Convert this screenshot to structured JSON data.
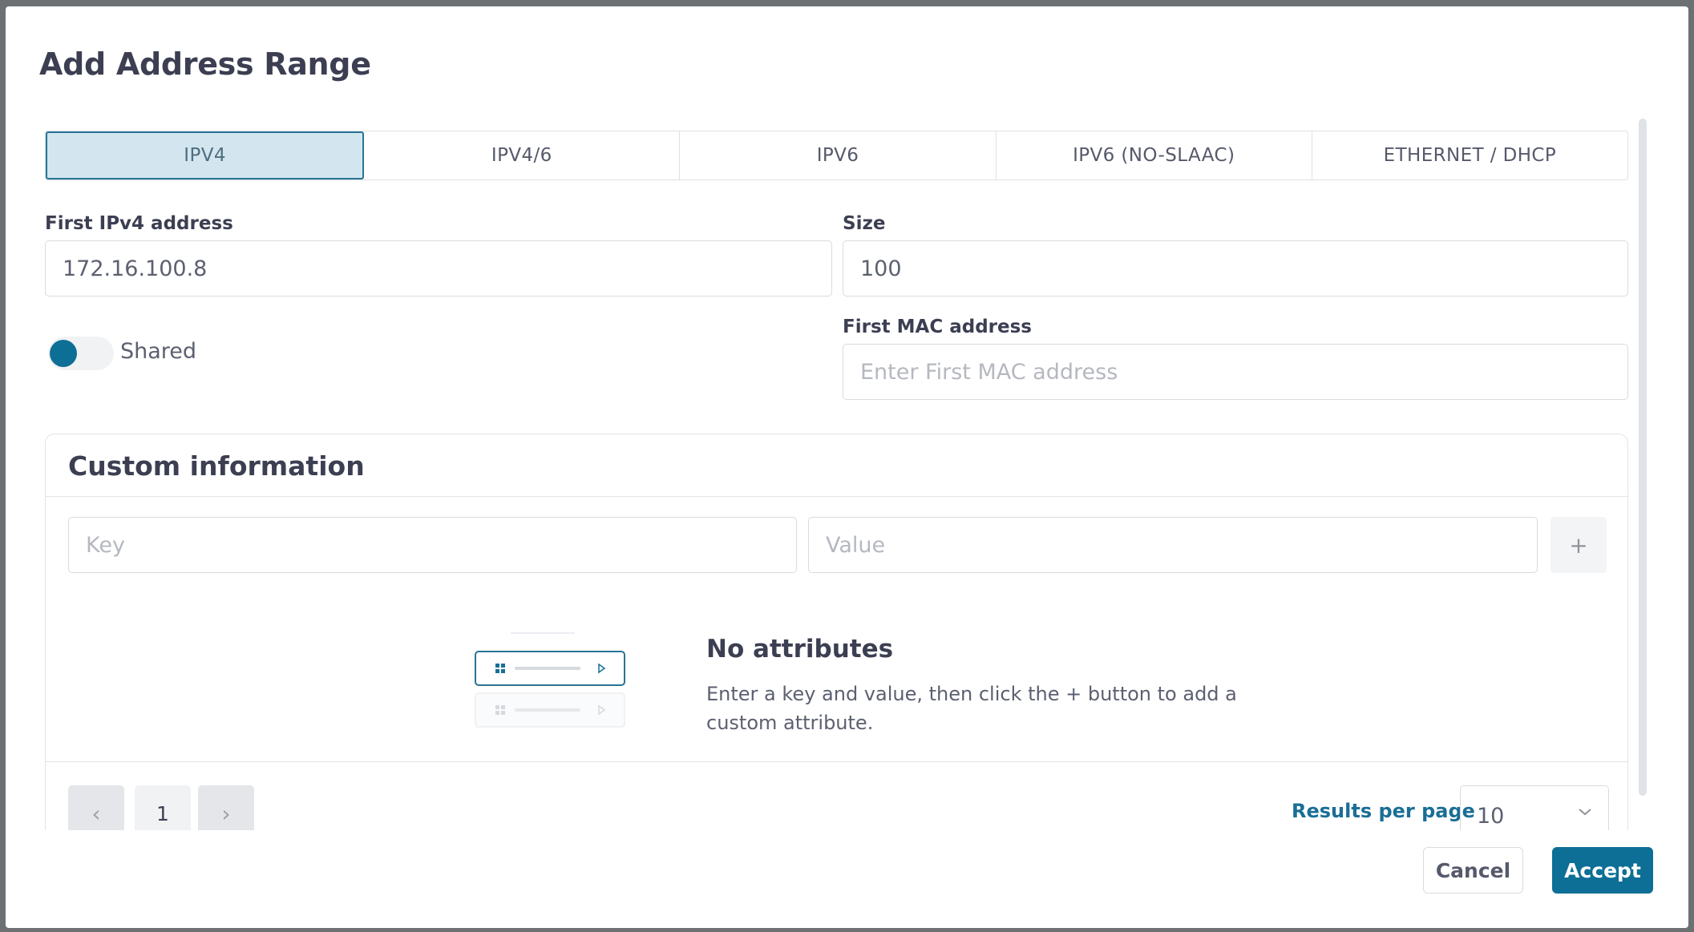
{
  "dialog": {
    "title": "Add Address Range"
  },
  "tabs": [
    {
      "label": "IPV4",
      "active": true
    },
    {
      "label": "IPV4/6",
      "active": false
    },
    {
      "label": "IPV6",
      "active": false
    },
    {
      "label": "IPV6 (NO-SLAAC)",
      "active": false
    },
    {
      "label": "ETHERNET / DHCP",
      "active": false
    }
  ],
  "form": {
    "first_ip_label": "First IPv4 address",
    "first_ip_value": "172.16.100.8",
    "size_label": "Size",
    "size_value": "100",
    "shared_label": "Shared",
    "shared_on": true,
    "first_mac_label": "First MAC address",
    "first_mac_placeholder": "Enter First MAC address"
  },
  "custom_info": {
    "title": "Custom information",
    "key_placeholder": "Key",
    "value_placeholder": "Value",
    "add_button": "+",
    "empty_title": "No attributes",
    "empty_description": "Enter a key and value, then click the + button to add a custom attribute."
  },
  "pagination": {
    "prev": "‹",
    "current_page": "1",
    "next": "›",
    "results_per_page_label": "Results per page",
    "results_per_page_value": "10"
  },
  "footer": {
    "cancel": "Cancel",
    "accept": "Accept"
  },
  "colors": {
    "accent": "#0e6f96",
    "active_tab_bg": "#d3e6ef",
    "text": "#3c3f52"
  }
}
